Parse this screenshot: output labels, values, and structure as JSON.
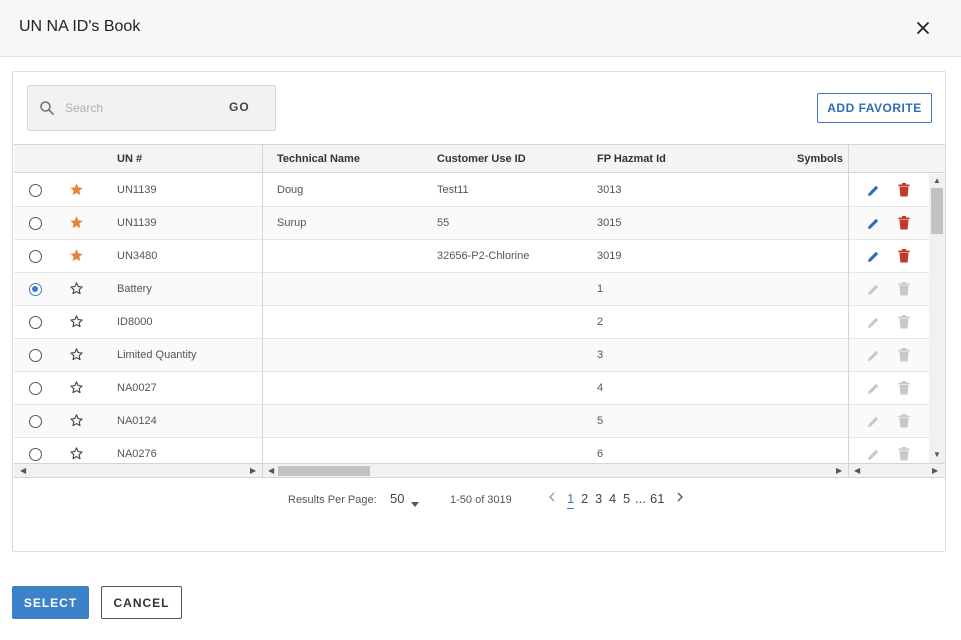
{
  "dialog": {
    "title": "UN NA ID's Book"
  },
  "toolbar": {
    "search_placeholder": "Search",
    "go_label": "GO",
    "add_favorite_label": "ADD FAVORITE"
  },
  "grid": {
    "columns": [
      "UN #",
      "Technical Name",
      "Customer Use ID",
      "FP Hazmat Id",
      "Symbols"
    ],
    "rows": [
      {
        "selected": false,
        "favorite": true,
        "un": "UN1139",
        "technical_name": "Doug",
        "customer_use_id": "Test11",
        "hazmat_id": "3013",
        "editable": true
      },
      {
        "selected": false,
        "favorite": true,
        "un": "UN1139",
        "technical_name": "Surup",
        "customer_use_id": "55",
        "hazmat_id": "3015",
        "editable": true
      },
      {
        "selected": false,
        "favorite": true,
        "un": "UN3480",
        "technical_name": "",
        "customer_use_id": "32656-P2-Chlorine",
        "hazmat_id": "3019",
        "editable": true
      },
      {
        "selected": true,
        "favorite": false,
        "un": "Battery",
        "technical_name": "",
        "customer_use_id": "",
        "hazmat_id": "1",
        "editable": false
      },
      {
        "selected": false,
        "favorite": false,
        "un": "ID8000",
        "technical_name": "",
        "customer_use_id": "",
        "hazmat_id": "2",
        "editable": false
      },
      {
        "selected": false,
        "favorite": false,
        "un": "Limited Quantity",
        "technical_name": "",
        "customer_use_id": "",
        "hazmat_id": "3",
        "editable": false
      },
      {
        "selected": false,
        "favorite": false,
        "un": "NA0027",
        "technical_name": "",
        "customer_use_id": "",
        "hazmat_id": "4",
        "editable": false
      },
      {
        "selected": false,
        "favorite": false,
        "un": "NA0124",
        "technical_name": "",
        "customer_use_id": "",
        "hazmat_id": "5",
        "editable": false
      },
      {
        "selected": false,
        "favorite": false,
        "un": "NA0276",
        "technical_name": "",
        "customer_use_id": "",
        "hazmat_id": "6",
        "editable": false
      }
    ]
  },
  "pagination": {
    "results_per_page_label": "Results Per Page:",
    "per_page": "50",
    "range": "1-50 of 3019",
    "pages": [
      "1",
      "2",
      "3",
      "4",
      "5"
    ],
    "ellipsis": "...",
    "last_page": "61",
    "current_page": "1"
  },
  "footer": {
    "select_label": "SELECT",
    "cancel_label": "CANCEL"
  },
  "colors": {
    "accent": "#3b82c9",
    "star_filled": "#e8833a",
    "delete_red": "#c0392b",
    "edit_blue": "#2f6db5",
    "disabled_icon": "#c8c8c8"
  },
  "icons": {
    "search": "search-icon",
    "close": "close-icon",
    "star": "star-icon",
    "edit": "pencil-icon",
    "delete": "trash-icon"
  }
}
